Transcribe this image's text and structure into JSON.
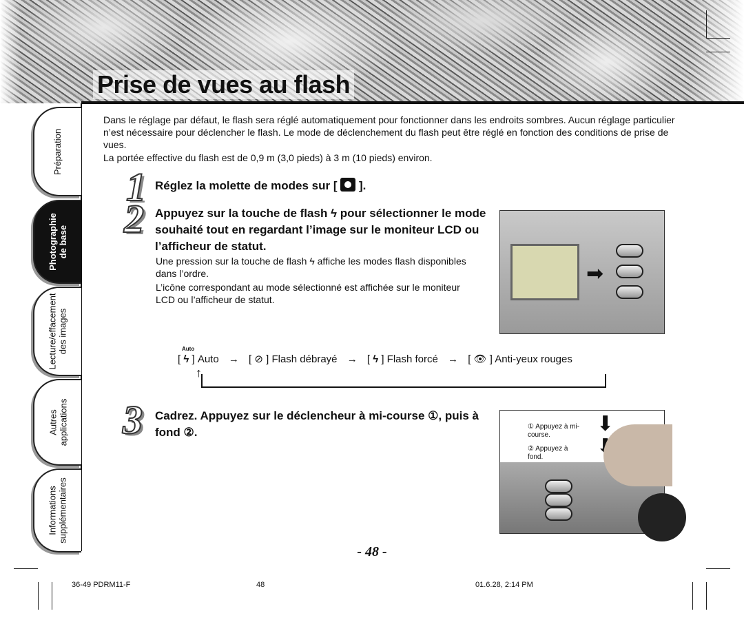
{
  "title": "Prise de vues au flash",
  "tabs": [
    {
      "label": "Préparation"
    },
    {
      "label": "Photographie\nde base"
    },
    {
      "label": "Lecture/effacement\ndes images"
    },
    {
      "label": "Autres\napplications"
    },
    {
      "label": "Informations\nsupplémentaires"
    }
  ],
  "active_tab": "Photographie de base",
  "intro": [
    "Dans le réglage par défaut, le flash sera réglé automatiquement pour fonctionner dans les endroits sombres. Aucun réglage particulier n’est nécessaire pour déclencher le flash. Le mode de déclenchement du flash peut être réglé en fonction des conditions de prise de vues.",
    "La portée effective du flash est de 0,9 m (3,0 pieds) à 3 m (10 pieds) environ."
  ],
  "steps": [
    {
      "num": "1",
      "title": "Réglez la molette de modes sur [",
      "title_end": "]."
    },
    {
      "num": "2",
      "title": "Appuyez sur la touche de flash ϟ pour sélectionner le mode souhaité tout en regardant l’image sur le moniteur LCD ou l’afficheur de statut.",
      "body": [
        "Une pression sur la touche de flash ϟ affiche les modes flash disponibles dans l’ordre.",
        "L’icône correspondant au mode sélectionné est affichée sur le moniteur LCD ou l’afficheur de statut."
      ]
    },
    {
      "num": "3",
      "title": "Cadrez. Appuyez sur le déclencheur à mi-course ①, puis à fond ②."
    }
  ],
  "flash_modes": [
    {
      "icon": "flash-auto-icon",
      "badge": "Auto",
      "label": "Auto"
    },
    {
      "icon": "flash-off-icon",
      "label": "Flash débrayé"
    },
    {
      "icon": "flash-forced-icon",
      "label": "Flash forcé"
    },
    {
      "icon": "red-eye-icon",
      "label": "Anti-yeux rouges"
    }
  ],
  "callouts": [
    "① Appuyez à mi-course.",
    "② Appuyez à fond."
  ],
  "page_number": "- 48 -",
  "footer": {
    "left": "36-49 PDRM11-F",
    "center": "48",
    "right": "01.6.28, 2:14 PM"
  }
}
